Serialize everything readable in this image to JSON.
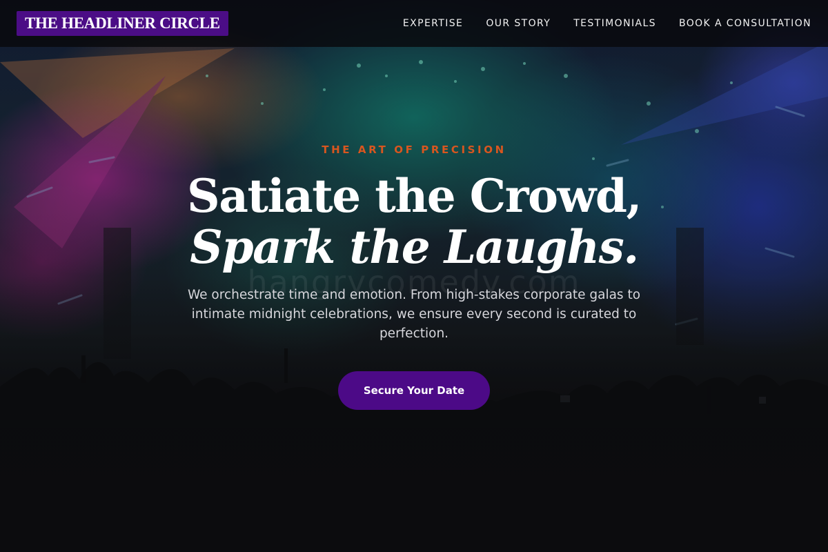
{
  "brand": {
    "name": "THE HEADLINER CIRCLE",
    "color": "#4b0d86"
  },
  "nav": {
    "links": [
      {
        "label": "EXPERTISE"
      },
      {
        "label": "OUR STORY"
      },
      {
        "label": "TESTIMONIALS"
      },
      {
        "label": "BOOK A CONSULTATION"
      }
    ]
  },
  "hero": {
    "eyebrow": "THE ART OF PRECISION",
    "headline_line1": "Satiate the Crowd,",
    "headline_line2": "Spark the Laughs.",
    "watermark": "hangrycomedy.com",
    "description": "We orchestrate time and emotion. From high-stakes corporate galas to intimate midnight celebrations, we ensure every second is curated to perfection.",
    "cta_label": "Secure Your Date",
    "accent_color": "#d9561f",
    "cta_color": "#4c0a87"
  }
}
